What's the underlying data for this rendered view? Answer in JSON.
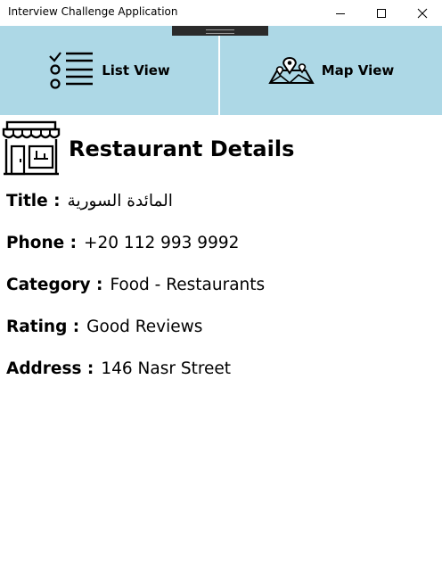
{
  "window": {
    "title": "Interview Challenge Application",
    "controls": [
      "minimize-icon",
      "maximize-icon",
      "close-icon"
    ]
  },
  "nav": {
    "list_view": {
      "label": "List View",
      "icon": "list-checklist-icon"
    },
    "map_view": {
      "label": "Map View",
      "icon": "map-pins-icon"
    },
    "background": "#add8e6"
  },
  "details": {
    "heading": "Restaurant Details",
    "icon": "storefront-icon",
    "fields": [
      {
        "label": "Title :",
        "value": "المائدة السورية"
      },
      {
        "label": "Phone :",
        "value": "+20 112 993 9992"
      },
      {
        "label": "Category :",
        "value": "Food - Restaurants"
      },
      {
        "label": "Rating :",
        "value": "Good Reviews"
      },
      {
        "label": "Address :",
        "value": "146 Nasr Street"
      }
    ]
  }
}
